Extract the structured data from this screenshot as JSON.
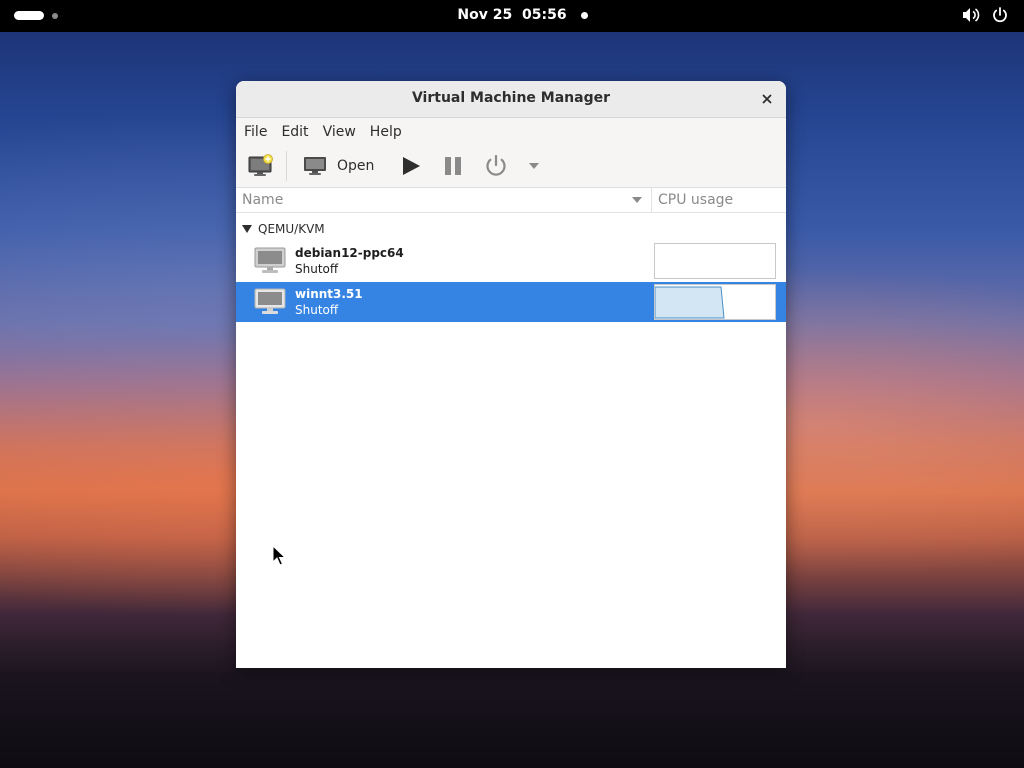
{
  "topbar": {
    "date": "Nov 25",
    "time": "05:56"
  },
  "window": {
    "title": "Virtual Machine Manager",
    "menu": [
      "File",
      "Edit",
      "View",
      "Help"
    ],
    "toolbar": {
      "open_label": "Open"
    },
    "columns": {
      "name": "Name",
      "cpu": "CPU usage"
    },
    "group": "QEMU/KVM",
    "vms": [
      {
        "name": "debian12-ppc64",
        "status": "Shutoff",
        "selected": false
      },
      {
        "name": "winnt3.51",
        "status": "Shutoff",
        "selected": true
      }
    ]
  },
  "colors": {
    "selection": "#3584e4",
    "topbar": "#000000"
  }
}
